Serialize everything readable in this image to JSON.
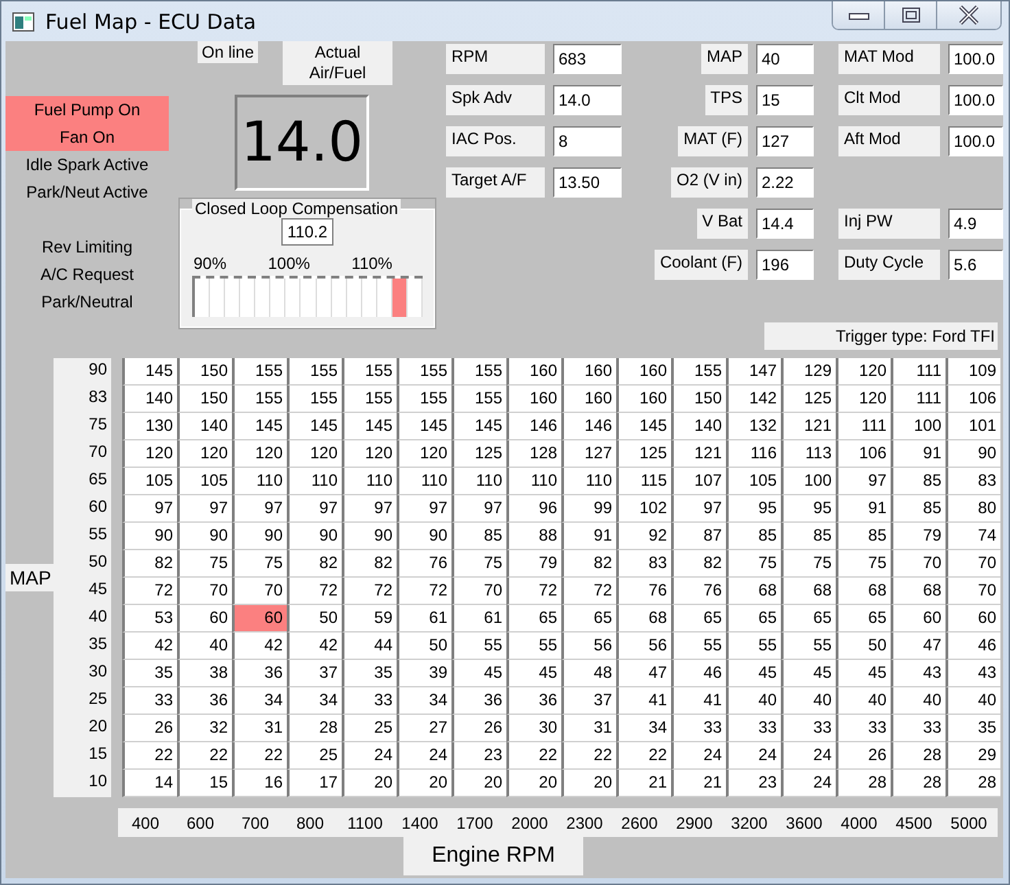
{
  "window": {
    "title": "Fuel Map - ECU Data"
  },
  "status_groups": [
    [
      {
        "label": "Fuel Pump On",
        "on": true
      },
      {
        "label": "Fan On",
        "on": true
      },
      {
        "label": "Idle Spark Active",
        "on": false
      },
      {
        "label": "Park/Neut Active",
        "on": false
      }
    ],
    [
      {
        "label": "Rev Limiting",
        "on": false
      },
      {
        "label": "A/C Request",
        "on": false
      },
      {
        "label": "Park/Neutral",
        "on": false
      }
    ]
  ],
  "online": {
    "label": "On line"
  },
  "air_fuel": {
    "label": "Actual Air/Fuel",
    "value": "14.0"
  },
  "closed_loop": {
    "title": "Closed Loop Compensation",
    "value": "110.2",
    "scale": [
      "90%",
      "100%",
      "110%"
    ],
    "level": 0.9
  },
  "field_columns": [
    [
      {
        "label": "RPM",
        "value": "683"
      },
      {
        "label": "Spk Adv",
        "value": "14.0"
      },
      {
        "label": "IAC Pos.",
        "value": "8"
      },
      {
        "label": "Target A/F",
        "value": "13.50"
      }
    ],
    [
      {
        "label": "MAP",
        "value": "40"
      },
      {
        "label": "TPS",
        "value": "15"
      },
      {
        "label": "MAT (F)",
        "value": "127"
      },
      {
        "label": "O2 (V in)",
        "value": "2.22"
      },
      {
        "label": "V Bat",
        "value": "14.4"
      },
      {
        "label": "Coolant (F)",
        "value": "196"
      }
    ],
    [
      {
        "label": "MAT Mod",
        "value": "100.0"
      },
      {
        "label": "Clt Mod",
        "value": "100.0"
      },
      {
        "label": "Aft Mod",
        "value": "100.0"
      },
      {
        "label": "Inj PW",
        "value": "4.9"
      },
      {
        "label": "Duty Cycle",
        "value": "5.6"
      }
    ]
  ],
  "trigger": "Trigger type: Ford TFI",
  "table": {
    "y_axis_title": "MAP",
    "rows": [
      {
        "map": "90",
        "cells": [
          {
            "value": "145",
            "selected": false
          },
          {
            "value": "150",
            "selected": false
          },
          {
            "value": "155",
            "selected": false
          },
          {
            "value": "155",
            "selected": false
          },
          {
            "value": "155",
            "selected": false
          },
          {
            "value": "155",
            "selected": false
          },
          {
            "value": "155",
            "selected": false
          },
          {
            "value": "160",
            "selected": false
          },
          {
            "value": "160",
            "selected": false
          },
          {
            "value": "160",
            "selected": false
          },
          {
            "value": "155",
            "selected": false
          },
          {
            "value": "147",
            "selected": false
          },
          {
            "value": "129",
            "selected": false
          },
          {
            "value": "120",
            "selected": false
          },
          {
            "value": "111",
            "selected": false
          },
          {
            "value": "109",
            "selected": false
          }
        ]
      },
      {
        "map": "83",
        "cells": [
          {
            "value": "140",
            "selected": false
          },
          {
            "value": "150",
            "selected": false
          },
          {
            "value": "155",
            "selected": false
          },
          {
            "value": "155",
            "selected": false
          },
          {
            "value": "155",
            "selected": false
          },
          {
            "value": "155",
            "selected": false
          },
          {
            "value": "155",
            "selected": false
          },
          {
            "value": "160",
            "selected": false
          },
          {
            "value": "160",
            "selected": false
          },
          {
            "value": "160",
            "selected": false
          },
          {
            "value": "150",
            "selected": false
          },
          {
            "value": "142",
            "selected": false
          },
          {
            "value": "125",
            "selected": false
          },
          {
            "value": "120",
            "selected": false
          },
          {
            "value": "111",
            "selected": false
          },
          {
            "value": "106",
            "selected": false
          }
        ]
      },
      {
        "map": "75",
        "cells": [
          {
            "value": "130",
            "selected": false
          },
          {
            "value": "140",
            "selected": false
          },
          {
            "value": "145",
            "selected": false
          },
          {
            "value": "145",
            "selected": false
          },
          {
            "value": "145",
            "selected": false
          },
          {
            "value": "145",
            "selected": false
          },
          {
            "value": "145",
            "selected": false
          },
          {
            "value": "146",
            "selected": false
          },
          {
            "value": "146",
            "selected": false
          },
          {
            "value": "145",
            "selected": false
          },
          {
            "value": "140",
            "selected": false
          },
          {
            "value": "132",
            "selected": false
          },
          {
            "value": "121",
            "selected": false
          },
          {
            "value": "111",
            "selected": false
          },
          {
            "value": "100",
            "selected": false
          },
          {
            "value": "101",
            "selected": false
          }
        ]
      },
      {
        "map": "70",
        "cells": [
          {
            "value": "120",
            "selected": false
          },
          {
            "value": "120",
            "selected": false
          },
          {
            "value": "120",
            "selected": false
          },
          {
            "value": "120",
            "selected": false
          },
          {
            "value": "120",
            "selected": false
          },
          {
            "value": "120",
            "selected": false
          },
          {
            "value": "125",
            "selected": false
          },
          {
            "value": "128",
            "selected": false
          },
          {
            "value": "127",
            "selected": false
          },
          {
            "value": "125",
            "selected": false
          },
          {
            "value": "121",
            "selected": false
          },
          {
            "value": "116",
            "selected": false
          },
          {
            "value": "113",
            "selected": false
          },
          {
            "value": "106",
            "selected": false
          },
          {
            "value": "91",
            "selected": false
          },
          {
            "value": "90",
            "selected": false
          }
        ]
      },
      {
        "map": "65",
        "cells": [
          {
            "value": "105",
            "selected": false
          },
          {
            "value": "105",
            "selected": false
          },
          {
            "value": "110",
            "selected": false
          },
          {
            "value": "110",
            "selected": false
          },
          {
            "value": "110",
            "selected": false
          },
          {
            "value": "110",
            "selected": false
          },
          {
            "value": "110",
            "selected": false
          },
          {
            "value": "110",
            "selected": false
          },
          {
            "value": "110",
            "selected": false
          },
          {
            "value": "115",
            "selected": false
          },
          {
            "value": "107",
            "selected": false
          },
          {
            "value": "105",
            "selected": false
          },
          {
            "value": "100",
            "selected": false
          },
          {
            "value": "97",
            "selected": false
          },
          {
            "value": "85",
            "selected": false
          },
          {
            "value": "83",
            "selected": false
          }
        ]
      },
      {
        "map": "60",
        "cells": [
          {
            "value": "97",
            "selected": false
          },
          {
            "value": "97",
            "selected": false
          },
          {
            "value": "97",
            "selected": false
          },
          {
            "value": "97",
            "selected": false
          },
          {
            "value": "97",
            "selected": false
          },
          {
            "value": "97",
            "selected": false
          },
          {
            "value": "97",
            "selected": false
          },
          {
            "value": "96",
            "selected": false
          },
          {
            "value": "99",
            "selected": false
          },
          {
            "value": "102",
            "selected": false
          },
          {
            "value": "97",
            "selected": false
          },
          {
            "value": "95",
            "selected": false
          },
          {
            "value": "95",
            "selected": false
          },
          {
            "value": "91",
            "selected": false
          },
          {
            "value": "85",
            "selected": false
          },
          {
            "value": "80",
            "selected": false
          }
        ]
      },
      {
        "map": "55",
        "cells": [
          {
            "value": "90",
            "selected": false
          },
          {
            "value": "90",
            "selected": false
          },
          {
            "value": "90",
            "selected": false
          },
          {
            "value": "90",
            "selected": false
          },
          {
            "value": "90",
            "selected": false
          },
          {
            "value": "90",
            "selected": false
          },
          {
            "value": "85",
            "selected": false
          },
          {
            "value": "88",
            "selected": false
          },
          {
            "value": "91",
            "selected": false
          },
          {
            "value": "92",
            "selected": false
          },
          {
            "value": "87",
            "selected": false
          },
          {
            "value": "85",
            "selected": false
          },
          {
            "value": "85",
            "selected": false
          },
          {
            "value": "85",
            "selected": false
          },
          {
            "value": "79",
            "selected": false
          },
          {
            "value": "74",
            "selected": false
          }
        ]
      },
      {
        "map": "50",
        "cells": [
          {
            "value": "82",
            "selected": false
          },
          {
            "value": "75",
            "selected": false
          },
          {
            "value": "75",
            "selected": false
          },
          {
            "value": "82",
            "selected": false
          },
          {
            "value": "82",
            "selected": false
          },
          {
            "value": "76",
            "selected": false
          },
          {
            "value": "75",
            "selected": false
          },
          {
            "value": "79",
            "selected": false
          },
          {
            "value": "82",
            "selected": false
          },
          {
            "value": "83",
            "selected": false
          },
          {
            "value": "82",
            "selected": false
          },
          {
            "value": "75",
            "selected": false
          },
          {
            "value": "75",
            "selected": false
          },
          {
            "value": "75",
            "selected": false
          },
          {
            "value": "70",
            "selected": false
          },
          {
            "value": "70",
            "selected": false
          }
        ]
      },
      {
        "map": "45",
        "cells": [
          {
            "value": "72",
            "selected": false
          },
          {
            "value": "70",
            "selected": false
          },
          {
            "value": "70",
            "selected": false
          },
          {
            "value": "72",
            "selected": false
          },
          {
            "value": "72",
            "selected": false
          },
          {
            "value": "72",
            "selected": false
          },
          {
            "value": "70",
            "selected": false
          },
          {
            "value": "72",
            "selected": false
          },
          {
            "value": "72",
            "selected": false
          },
          {
            "value": "76",
            "selected": false
          },
          {
            "value": "76",
            "selected": false
          },
          {
            "value": "68",
            "selected": false
          },
          {
            "value": "68",
            "selected": false
          },
          {
            "value": "68",
            "selected": false
          },
          {
            "value": "68",
            "selected": false
          },
          {
            "value": "70",
            "selected": false
          }
        ]
      },
      {
        "map": "40",
        "cells": [
          {
            "value": "53",
            "selected": false
          },
          {
            "value": "60",
            "selected": false
          },
          {
            "value": "60",
            "selected": true
          },
          {
            "value": "50",
            "selected": false
          },
          {
            "value": "59",
            "selected": false
          },
          {
            "value": "61",
            "selected": false
          },
          {
            "value": "61",
            "selected": false
          },
          {
            "value": "65",
            "selected": false
          },
          {
            "value": "65",
            "selected": false
          },
          {
            "value": "68",
            "selected": false
          },
          {
            "value": "65",
            "selected": false
          },
          {
            "value": "65",
            "selected": false
          },
          {
            "value": "65",
            "selected": false
          },
          {
            "value": "65",
            "selected": false
          },
          {
            "value": "60",
            "selected": false
          },
          {
            "value": "60",
            "selected": false
          }
        ]
      },
      {
        "map": "35",
        "cells": [
          {
            "value": "42",
            "selected": false
          },
          {
            "value": "40",
            "selected": false
          },
          {
            "value": "42",
            "selected": false
          },
          {
            "value": "42",
            "selected": false
          },
          {
            "value": "44",
            "selected": false
          },
          {
            "value": "50",
            "selected": false
          },
          {
            "value": "55",
            "selected": false
          },
          {
            "value": "55",
            "selected": false
          },
          {
            "value": "56",
            "selected": false
          },
          {
            "value": "56",
            "selected": false
          },
          {
            "value": "55",
            "selected": false
          },
          {
            "value": "55",
            "selected": false
          },
          {
            "value": "55",
            "selected": false
          },
          {
            "value": "50",
            "selected": false
          },
          {
            "value": "47",
            "selected": false
          },
          {
            "value": "46",
            "selected": false
          }
        ]
      },
      {
        "map": "30",
        "cells": [
          {
            "value": "35",
            "selected": false
          },
          {
            "value": "38",
            "selected": false
          },
          {
            "value": "36",
            "selected": false
          },
          {
            "value": "37",
            "selected": false
          },
          {
            "value": "35",
            "selected": false
          },
          {
            "value": "39",
            "selected": false
          },
          {
            "value": "45",
            "selected": false
          },
          {
            "value": "45",
            "selected": false
          },
          {
            "value": "48",
            "selected": false
          },
          {
            "value": "47",
            "selected": false
          },
          {
            "value": "46",
            "selected": false
          },
          {
            "value": "45",
            "selected": false
          },
          {
            "value": "45",
            "selected": false
          },
          {
            "value": "45",
            "selected": false
          },
          {
            "value": "43",
            "selected": false
          },
          {
            "value": "43",
            "selected": false
          }
        ]
      },
      {
        "map": "25",
        "cells": [
          {
            "value": "33",
            "selected": false
          },
          {
            "value": "36",
            "selected": false
          },
          {
            "value": "34",
            "selected": false
          },
          {
            "value": "34",
            "selected": false
          },
          {
            "value": "33",
            "selected": false
          },
          {
            "value": "34",
            "selected": false
          },
          {
            "value": "36",
            "selected": false
          },
          {
            "value": "36",
            "selected": false
          },
          {
            "value": "37",
            "selected": false
          },
          {
            "value": "41",
            "selected": false
          },
          {
            "value": "41",
            "selected": false
          },
          {
            "value": "40",
            "selected": false
          },
          {
            "value": "40",
            "selected": false
          },
          {
            "value": "40",
            "selected": false
          },
          {
            "value": "40",
            "selected": false
          },
          {
            "value": "40",
            "selected": false
          }
        ]
      },
      {
        "map": "20",
        "cells": [
          {
            "value": "26",
            "selected": false
          },
          {
            "value": "32",
            "selected": false
          },
          {
            "value": "31",
            "selected": false
          },
          {
            "value": "28",
            "selected": false
          },
          {
            "value": "25",
            "selected": false
          },
          {
            "value": "27",
            "selected": false
          },
          {
            "value": "26",
            "selected": false
          },
          {
            "value": "30",
            "selected": false
          },
          {
            "value": "31",
            "selected": false
          },
          {
            "value": "34",
            "selected": false
          },
          {
            "value": "33",
            "selected": false
          },
          {
            "value": "33",
            "selected": false
          },
          {
            "value": "33",
            "selected": false
          },
          {
            "value": "33",
            "selected": false
          },
          {
            "value": "33",
            "selected": false
          },
          {
            "value": "35",
            "selected": false
          }
        ]
      },
      {
        "map": "15",
        "cells": [
          {
            "value": "22",
            "selected": false
          },
          {
            "value": "22",
            "selected": false
          },
          {
            "value": "22",
            "selected": false
          },
          {
            "value": "25",
            "selected": false
          },
          {
            "value": "24",
            "selected": false
          },
          {
            "value": "24",
            "selected": false
          },
          {
            "value": "23",
            "selected": false
          },
          {
            "value": "22",
            "selected": false
          },
          {
            "value": "22",
            "selected": false
          },
          {
            "value": "22",
            "selected": false
          },
          {
            "value": "24",
            "selected": false
          },
          {
            "value": "24",
            "selected": false
          },
          {
            "value": "24",
            "selected": false
          },
          {
            "value": "26",
            "selected": false
          },
          {
            "value": "28",
            "selected": false
          },
          {
            "value": "29",
            "selected": false
          }
        ]
      },
      {
        "map": "10",
        "cells": [
          {
            "value": "14",
            "selected": false
          },
          {
            "value": "15",
            "selected": false
          },
          {
            "value": "16",
            "selected": false
          },
          {
            "value": "17",
            "selected": false
          },
          {
            "value": "20",
            "selected": false
          },
          {
            "value": "20",
            "selected": false
          },
          {
            "value": "20",
            "selected": false
          },
          {
            "value": "20",
            "selected": false
          },
          {
            "value": "20",
            "selected": false
          },
          {
            "value": "21",
            "selected": false
          },
          {
            "value": "21",
            "selected": false
          },
          {
            "value": "23",
            "selected": false
          },
          {
            "value": "24",
            "selected": false
          },
          {
            "value": "28",
            "selected": false
          },
          {
            "value": "28",
            "selected": false
          },
          {
            "value": "28",
            "selected": false
          }
        ]
      }
    ]
  },
  "rpm_axis": {
    "labels": [
      "400",
      "600",
      "700",
      "800",
      "1100",
      "1400",
      "1700",
      "2000",
      "2300",
      "2600",
      "2900",
      "3200",
      "3600",
      "4000",
      "4500",
      "5000"
    ],
    "title": "Engine RPM"
  }
}
